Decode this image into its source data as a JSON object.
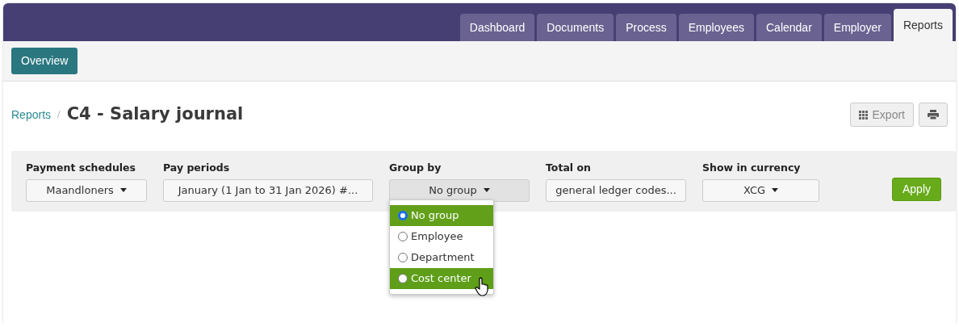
{
  "tabs": [
    {
      "label": "Dashboard",
      "selected": false
    },
    {
      "label": "Documents",
      "selected": false
    },
    {
      "label": "Process",
      "selected": false
    },
    {
      "label": "Employees",
      "selected": false
    },
    {
      "label": "Calendar",
      "selected": false
    },
    {
      "label": "Employer",
      "selected": false
    },
    {
      "label": "Reports",
      "selected": true
    }
  ],
  "subnav": {
    "buttons": [
      "Overview"
    ]
  },
  "breadcrumb": {
    "parent": "Reports",
    "separator": "/",
    "title": "C4 - Salary journal"
  },
  "toolbar": {
    "export": "Export",
    "export_disabled": true
  },
  "filters": [
    {
      "label": "Payment schedules",
      "value": "Maandloners",
      "kind": "dropdown",
      "open": false
    },
    {
      "label": "Pay periods",
      "value": "January (1 Jan to 31 Jan 2026) #...",
      "kind": "field",
      "open": false
    },
    {
      "label": "Group by",
      "value": "No group",
      "kind": "dropdown",
      "open": true
    },
    {
      "label": "Total on",
      "value": "general ledger codes...",
      "kind": "field",
      "open": false
    },
    {
      "label": "Show in currency",
      "value": "XCG",
      "kind": "dropdown",
      "open": false
    }
  ],
  "apply_button": "Apply",
  "group_menu": [
    {
      "label": "No group",
      "selected": true,
      "hovered": false
    },
    {
      "label": "Employee",
      "selected": false,
      "hovered": false
    },
    {
      "label": "Department",
      "selected": false,
      "hovered": false
    },
    {
      "label": "Cost center",
      "selected": false,
      "hovered": true
    }
  ]
}
